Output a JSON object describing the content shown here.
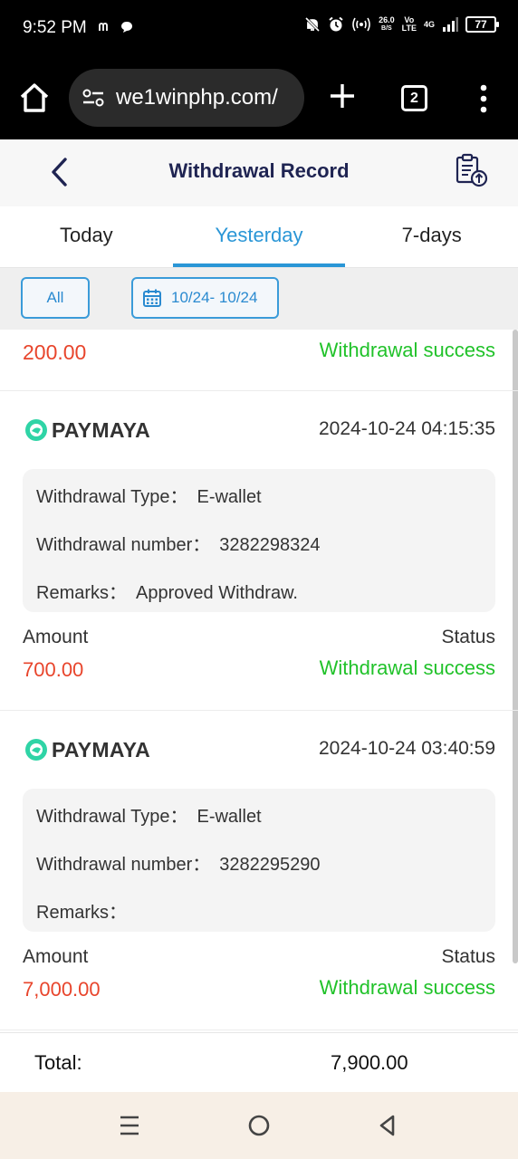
{
  "status_bar": {
    "time": "9:52 PM",
    "net_speed_value": "26.0",
    "net_speed_unit": "B/S",
    "volte_top": "Vo",
    "volte_bottom": "LTE",
    "network": "4G",
    "battery": "77"
  },
  "browser": {
    "url": "we1winphp.com/",
    "tab_count": "2"
  },
  "header": {
    "title": "Withdrawal Record"
  },
  "tabs": [
    {
      "label": "Today",
      "active": false
    },
    {
      "label": "Yesterday",
      "active": true
    },
    {
      "label": "7-days",
      "active": false
    }
  ],
  "filter": {
    "all_label": "All",
    "date_range": "10/24- 10/24"
  },
  "partial_record": {
    "amount": "200.00",
    "status": "Withdrawal success"
  },
  "records": [
    {
      "method": "PAYMAYA",
      "datetime": "2024-10-24 04:15:35",
      "type_label": "Withdrawal Type：",
      "type_value": "E-wallet",
      "number_label": "Withdrawal number：",
      "number_value": "3282298324",
      "remarks_label": "Remarks：",
      "remarks_value": "Approved Withdraw.",
      "amount_label": "Amount",
      "amount": "700.00",
      "status_label": "Status",
      "status": "Withdrawal success"
    },
    {
      "method": "PAYMAYA",
      "datetime": "2024-10-24 03:40:59",
      "type_label": "Withdrawal Type：",
      "type_value": "E-wallet",
      "number_label": "Withdrawal number：",
      "number_value": "3282295290",
      "remarks_label": "Remarks：",
      "remarks_value": "",
      "amount_label": "Amount",
      "amount": "7,000.00",
      "status_label": "Status",
      "status": "Withdrawal success"
    }
  ],
  "total": {
    "label": "Total:",
    "value": "7,900.00"
  },
  "colors": {
    "accent": "#2a96d6",
    "amount": "#e8452c",
    "success": "#21c22a",
    "title": "#1f2452",
    "paymaya": "#2fd4a6"
  },
  "icons": {
    "back": "chevron-left-icon",
    "record": "clipboard-upload-icon",
    "calendar": "calendar-icon",
    "paymaya": "paymaya-logo-icon"
  }
}
